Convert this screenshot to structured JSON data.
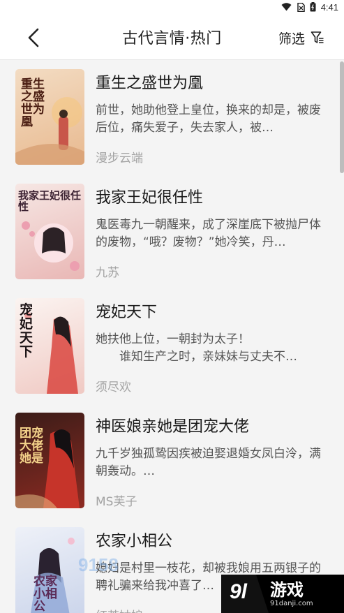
{
  "status_bar": {
    "time": "4:41",
    "icons": [
      "wifi-icon",
      "no-sim-icon",
      "battery-icon"
    ]
  },
  "header": {
    "back_icon": "chevron-left-icon",
    "title": "古代言情·热门",
    "filter_label": "筛选",
    "filter_icon": "filter-icon"
  },
  "books": [
    {
      "title": "重生之盛世为凰",
      "desc": "前世，她助他登上皇位，换来的却是，被废后位，痛失爱子，失去家人，被…",
      "author": "漫步云端",
      "cover_text": "重生之盛世为凰",
      "cover_colors": [
        "#f3dcc3",
        "#e8b98f"
      ]
    },
    {
      "title": "我家王妃很任性",
      "desc": "鬼医毒九一朝醒来，成了深崖底下被抛尸体的废物，“哦？废物？”她冷笑，丹…",
      "author": "九苏",
      "cover_text": "我家王妃很任性",
      "cover_colors": [
        "#f6e7e4",
        "#e9b7b5"
      ]
    },
    {
      "title": "宠妃天下",
      "desc": "她扶他上位，一朝封为太子！\n　　谁知生产之时，亲妹妹与丈夫不…",
      "author": "须尽欢",
      "cover_text": "宠妃天下",
      "cover_colors": [
        "#fbf4f1",
        "#f0c9c3"
      ]
    },
    {
      "title": "神医娘亲她是团宠大佬",
      "desc": "九千岁独孤鸷因疾被迫娶退婚女凤白泠，满朝轰动。…",
      "author": "MS芙子",
      "cover_text": "团宠大佬她是",
      "cover_colors": [
        "#3a1c18",
        "#8e2b22"
      ]
    },
    {
      "title": "农家小相公",
      "desc": "媳妇是村里一枝花，却被我娘用五两银子的聘礼骗来给我冲喜了…",
      "author": "红茶姑娘",
      "cover_text": "农家小相公",
      "cover_colors": [
        "#eef1f8",
        "#c9d3ea"
      ]
    }
  ],
  "watermark": {
    "brand": "游戏",
    "logo_text": "9l",
    "url": "91danji.com",
    "faint_logo": "9158"
  }
}
